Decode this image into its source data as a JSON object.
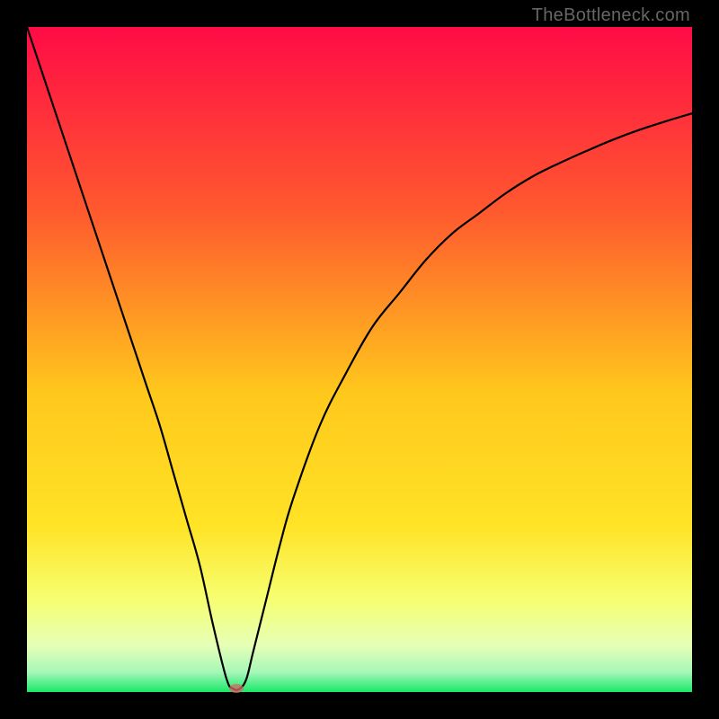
{
  "watermark": "TheBottleneck.com",
  "colors": {
    "top": "#ff0b46",
    "mid_upper": "#ff6a2b",
    "mid": "#ffd81a",
    "mid_lower": "#f5ff63",
    "near_bottom": "#d4ffb0",
    "bottom": "#19e86a",
    "curve": "#000000",
    "marker": "#d86b6b"
  },
  "chart_data": {
    "type": "line",
    "title": "",
    "xlabel": "",
    "ylabel": "",
    "xlim": [
      0,
      100
    ],
    "ylim": [
      0,
      100
    ],
    "series": [
      {
        "name": "bottleneck-curve",
        "x": [
          0,
          2,
          4,
          6,
          8,
          10,
          12,
          14,
          16,
          18,
          20,
          22,
          24,
          26,
          28,
          30,
          31,
          32,
          33,
          34,
          36,
          38,
          40,
          44,
          48,
          52,
          56,
          60,
          64,
          68,
          72,
          76,
          80,
          84,
          88,
          92,
          96,
          100
        ],
        "values": [
          100,
          94,
          88,
          82,
          76,
          70,
          64,
          58,
          52,
          46,
          40,
          33,
          26,
          19,
          10,
          2,
          0.5,
          0.5,
          2,
          6,
          14,
          22,
          29,
          40,
          48,
          55,
          60,
          65,
          69,
          72,
          75,
          77.5,
          79.5,
          81.3,
          83,
          84.5,
          85.8,
          87
        ]
      }
    ],
    "annotations": [
      {
        "type": "minimum-marker",
        "x": 31.5,
        "y": 0.5
      }
    ]
  }
}
